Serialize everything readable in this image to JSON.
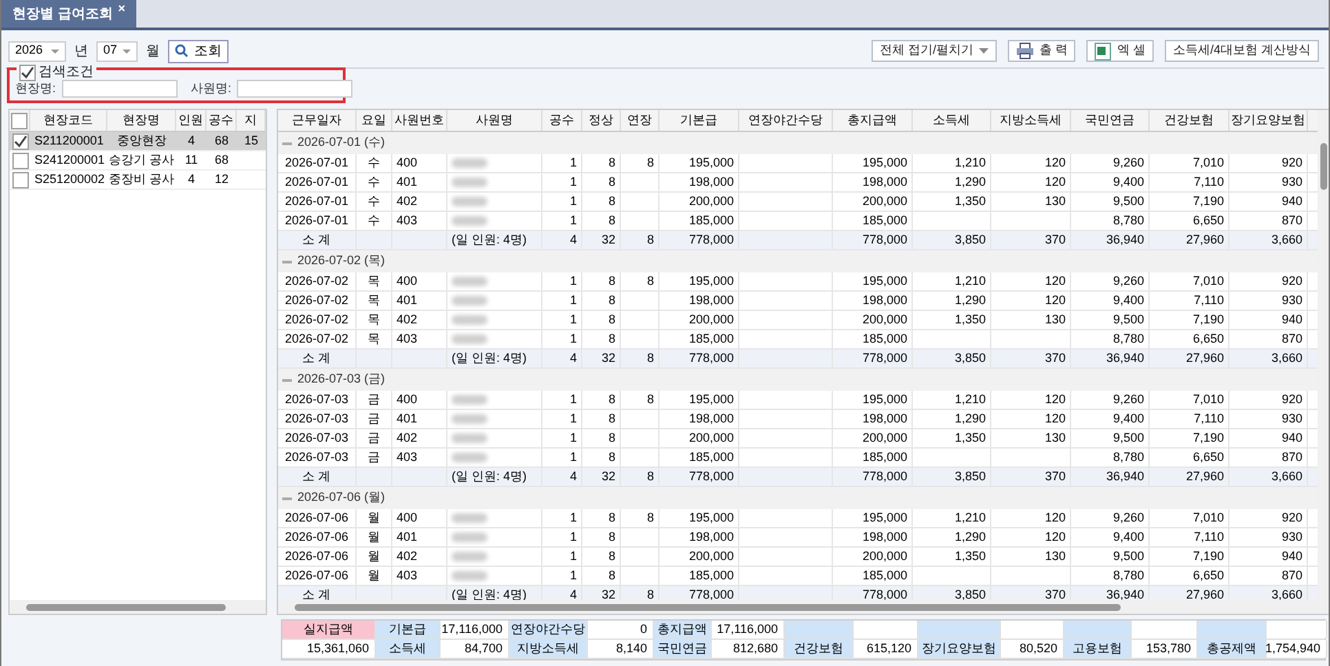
{
  "tab": {
    "title": "현장별 급여조회",
    "close": "×"
  },
  "toolbar": {
    "year": "2026",
    "year_unit": "년",
    "month": "07",
    "month_unit": "월",
    "search_button": "조회",
    "actions": [
      {
        "label": "전체 접기/펼치기",
        "kind": "dropdown"
      },
      {
        "label": "출 력",
        "kind": "print"
      },
      {
        "label": "엑 셀",
        "kind": "excel"
      },
      {
        "label": "소득세/4대보험 계산방식",
        "kind": "plain"
      }
    ]
  },
  "search_conditions": {
    "label": "검색조건",
    "checked": true,
    "highlighted": true,
    "fields": [
      {
        "label": "현장명:"
      },
      {
        "label": "사원명:"
      }
    ]
  },
  "sites": {
    "all_checked": false,
    "columns": [
      "현장코드",
      "현장명",
      "인원",
      "공수",
      "지"
    ],
    "rows": [
      {
        "checked": true,
        "selected": true,
        "cells": [
          "S211200001",
          "중앙현장",
          "4",
          "68",
          "15"
        ]
      },
      {
        "checked": false,
        "selected": false,
        "cells": [
          "S241200001",
          "승강기 공사",
          "11",
          "68",
          null
        ]
      },
      {
        "checked": false,
        "selected": false,
        "cells": [
          "S251200002",
          "중장비 공사",
          "4",
          "12",
          null
        ]
      }
    ]
  },
  "payroll": {
    "columns": [
      "근무일자",
      "요일",
      "사원번호",
      "사원명",
      "공수",
      "정상",
      "연장",
      "기본급",
      "연장야간수당",
      "총지급액",
      "소득세",
      "지방소득세",
      "국민연금",
      "건강보험",
      "장기요양보험"
    ],
    "groups": [
      {
        "title": "2026-07-01 (수)",
        "expanded": true,
        "rows": [
          {
            "kind": "employee",
            "cells": [
              "2026-07-01",
              "수",
              "400",
              null,
              "1",
              "8",
              "8",
              "195,000",
              null,
              "195,000",
              "1,210",
              "120",
              "9,260",
              "7,010",
              "920"
            ]
          },
          {
            "kind": "employee",
            "cells": [
              "2026-07-01",
              "수",
              "401",
              null,
              "1",
              "8",
              null,
              "198,000",
              null,
              "198,000",
              "1,290",
              "120",
              "9,400",
              "7,110",
              "930"
            ]
          },
          {
            "kind": "employee",
            "cells": [
              "2026-07-01",
              "수",
              "402",
              null,
              "1",
              "8",
              null,
              "200,000",
              null,
              "200,000",
              "1,350",
              "130",
              "9,500",
              "7,190",
              "940"
            ]
          },
          {
            "kind": "employee",
            "cells": [
              "2026-07-01",
              "수",
              "403",
              null,
              "1",
              "8",
              null,
              "185,000",
              null,
              "185,000",
              null,
              null,
              "8,780",
              "6,650",
              "870"
            ]
          },
          {
            "kind": "subtotal",
            "cells": [
              "소 계",
              null,
              null,
              "(일 인원: 4명)",
              "4",
              "32",
              "8",
              "778,000",
              null,
              "778,000",
              "3,850",
              "370",
              "36,940",
              "27,960",
              "3,660"
            ]
          }
        ]
      },
      {
        "title": "2026-07-02 (목)",
        "expanded": true,
        "rows": [
          {
            "kind": "employee",
            "cells": [
              "2026-07-02",
              "목",
              "400",
              null,
              "1",
              "8",
              "8",
              "195,000",
              null,
              "195,000",
              "1,210",
              "120",
              "9,260",
              "7,010",
              "920"
            ]
          },
          {
            "kind": "employee",
            "cells": [
              "2026-07-02",
              "목",
              "401",
              null,
              "1",
              "8",
              null,
              "198,000",
              null,
              "198,000",
              "1,290",
              "120",
              "9,400",
              "7,110",
              "930"
            ]
          },
          {
            "kind": "employee",
            "cells": [
              "2026-07-02",
              "목",
              "402",
              null,
              "1",
              "8",
              null,
              "200,000",
              null,
              "200,000",
              "1,350",
              "130",
              "9,500",
              "7,190",
              "940"
            ]
          },
          {
            "kind": "employee",
            "cells": [
              "2026-07-02",
              "목",
              "403",
              null,
              "1",
              "8",
              null,
              "185,000",
              null,
              "185,000",
              null,
              null,
              "8,780",
              "6,650",
              "870"
            ]
          },
          {
            "kind": "subtotal",
            "cells": [
              "소 계",
              null,
              null,
              "(일 인원: 4명)",
              "4",
              "32",
              "8",
              "778,000",
              null,
              "778,000",
              "3,850",
              "370",
              "36,940",
              "27,960",
              "3,660"
            ]
          }
        ]
      },
      {
        "title": "2026-07-03 (금)",
        "expanded": true,
        "rows": [
          {
            "kind": "employee",
            "cells": [
              "2026-07-03",
              "금",
              "400",
              null,
              "1",
              "8",
              "8",
              "195,000",
              null,
              "195,000",
              "1,210",
              "120",
              "9,260",
              "7,010",
              "920"
            ]
          },
          {
            "kind": "employee",
            "cells": [
              "2026-07-03",
              "금",
              "401",
              null,
              "1",
              "8",
              null,
              "198,000",
              null,
              "198,000",
              "1,290",
              "120",
              "9,400",
              "7,110",
              "930"
            ]
          },
          {
            "kind": "employee",
            "cells": [
              "2026-07-03",
              "금",
              "402",
              null,
              "1",
              "8",
              null,
              "200,000",
              null,
              "200,000",
              "1,350",
              "130",
              "9,500",
              "7,190",
              "940"
            ]
          },
          {
            "kind": "employee",
            "cells": [
              "2026-07-03",
              "금",
              "403",
              null,
              "1",
              "8",
              null,
              "185,000",
              null,
              "185,000",
              null,
              null,
              "8,780",
              "6,650",
              "870"
            ]
          },
          {
            "kind": "subtotal",
            "cells": [
              "소 계",
              null,
              null,
              "(일 인원: 4명)",
              "4",
              "32",
              "8",
              "778,000",
              null,
              "778,000",
              "3,850",
              "370",
              "36,940",
              "27,960",
              "3,660"
            ]
          }
        ]
      },
      {
        "title": "2026-07-06 (월)",
        "expanded": true,
        "rows": [
          {
            "kind": "employee",
            "cells": [
              "2026-07-06",
              "월",
              "400",
              null,
              "1",
              "8",
              "8",
              "195,000",
              null,
              "195,000",
              "1,210",
              "120",
              "9,260",
              "7,010",
              "920"
            ]
          },
          {
            "kind": "employee",
            "cells": [
              "2026-07-06",
              "월",
              "401",
              null,
              "1",
              "8",
              null,
              "198,000",
              null,
              "198,000",
              "1,290",
              "120",
              "9,400",
              "7,110",
              "930"
            ]
          },
          {
            "kind": "employee",
            "cells": [
              "2026-07-06",
              "월",
              "402",
              null,
              "1",
              "8",
              null,
              "200,000",
              null,
              "200,000",
              "1,350",
              "130",
              "9,500",
              "7,190",
              "940"
            ]
          },
          {
            "kind": "employee",
            "cells": [
              "2026-07-06",
              "월",
              "403",
              null,
              "1",
              "8",
              null,
              "185,000",
              null,
              "185,000",
              null,
              null,
              "8,780",
              "6,650",
              "870"
            ]
          },
          {
            "kind": "subtotal",
            "cells": [
              "소 계",
              null,
              null,
              "(일 인원: 4명)",
              "4",
              "32",
              "8",
              "778,000",
              null,
              "778,000",
              "3,850",
              "370",
              "36,940",
              "27,960",
              "3,660"
            ]
          }
        ]
      }
    ]
  },
  "summary": {
    "rows": [
      [
        {
          "kind": "key",
          "text": "실지급액"
        },
        {
          "kind": "label",
          "text": "기본급"
        },
        {
          "kind": "value",
          "text": "17,116,000"
        },
        {
          "kind": "label",
          "text": "연장야간수당"
        },
        {
          "kind": "value",
          "text": "0"
        },
        {
          "kind": "label",
          "text": "총지급액"
        },
        {
          "kind": "value",
          "text": "17,116,000"
        },
        {
          "kind": "label"
        },
        {
          "kind": "value"
        },
        {
          "kind": "label"
        },
        {
          "kind": "value"
        },
        {
          "kind": "label"
        },
        {
          "kind": "value"
        },
        {
          "kind": "label"
        },
        {
          "kind": "value"
        }
      ],
      [
        {
          "kind": "value",
          "text": "15,361,060"
        },
        {
          "kind": "label",
          "text": "소득세"
        },
        {
          "kind": "value",
          "text": "84,700"
        },
        {
          "kind": "label",
          "text": "지방소득세"
        },
        {
          "kind": "value",
          "text": "8,140"
        },
        {
          "kind": "label",
          "text": "국민연금"
        },
        {
          "kind": "value",
          "text": "812,680"
        },
        {
          "kind": "label",
          "text": "건강보험"
        },
        {
          "kind": "value",
          "text": "615,120"
        },
        {
          "kind": "label",
          "text": "장기요양보험"
        },
        {
          "kind": "value",
          "text": "80,520"
        },
        {
          "kind": "label",
          "text": "고용보험"
        },
        {
          "kind": "value",
          "text": "153,780"
        },
        {
          "kind": "label",
          "text": "총공제액"
        },
        {
          "kind": "value",
          "text": "1,754,940"
        }
      ]
    ]
  }
}
